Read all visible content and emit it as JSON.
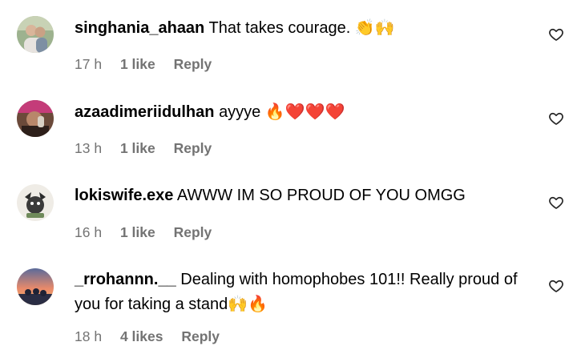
{
  "comments": [
    {
      "username": "singhania_ahaan",
      "text": "That takes courage.",
      "emoji": "👏🙌",
      "time": "17 h",
      "likes": "1 like",
      "reply": "Reply",
      "avatar_colors": [
        "#a3b39a",
        "#c9b7a4"
      ]
    },
    {
      "username": "azaadimeriidulhan",
      "text": "ayyye",
      "emoji": "🔥❤️❤️❤️",
      "time": "13 h",
      "likes": "1 like",
      "reply": "Reply",
      "avatar_colors": [
        "#c73a78",
        "#5a3b30"
      ]
    },
    {
      "username": "lokiswife.exe",
      "text": "AWWW IM SO PROUD OF YOU OMGG",
      "emoji": "",
      "time": "16 h",
      "likes": "1 like",
      "reply": "Reply",
      "avatar_colors": [
        "#e9e6df",
        "#2b2b2b"
      ]
    },
    {
      "username": "_rrohannn.__",
      "text": "Dealing with homophobes 101!! Really proud of you for taking a stand",
      "emoji": "🙌🔥",
      "time": "18 h",
      "likes": "4 likes",
      "reply": "Reply",
      "avatar_colors": [
        "#e98a6a",
        "#3a3f5c"
      ]
    }
  ],
  "heart_icon": "heart-outline-icon",
  "colors": {
    "meta_text": "#737373",
    "text": "#000000",
    "background": "#ffffff"
  }
}
